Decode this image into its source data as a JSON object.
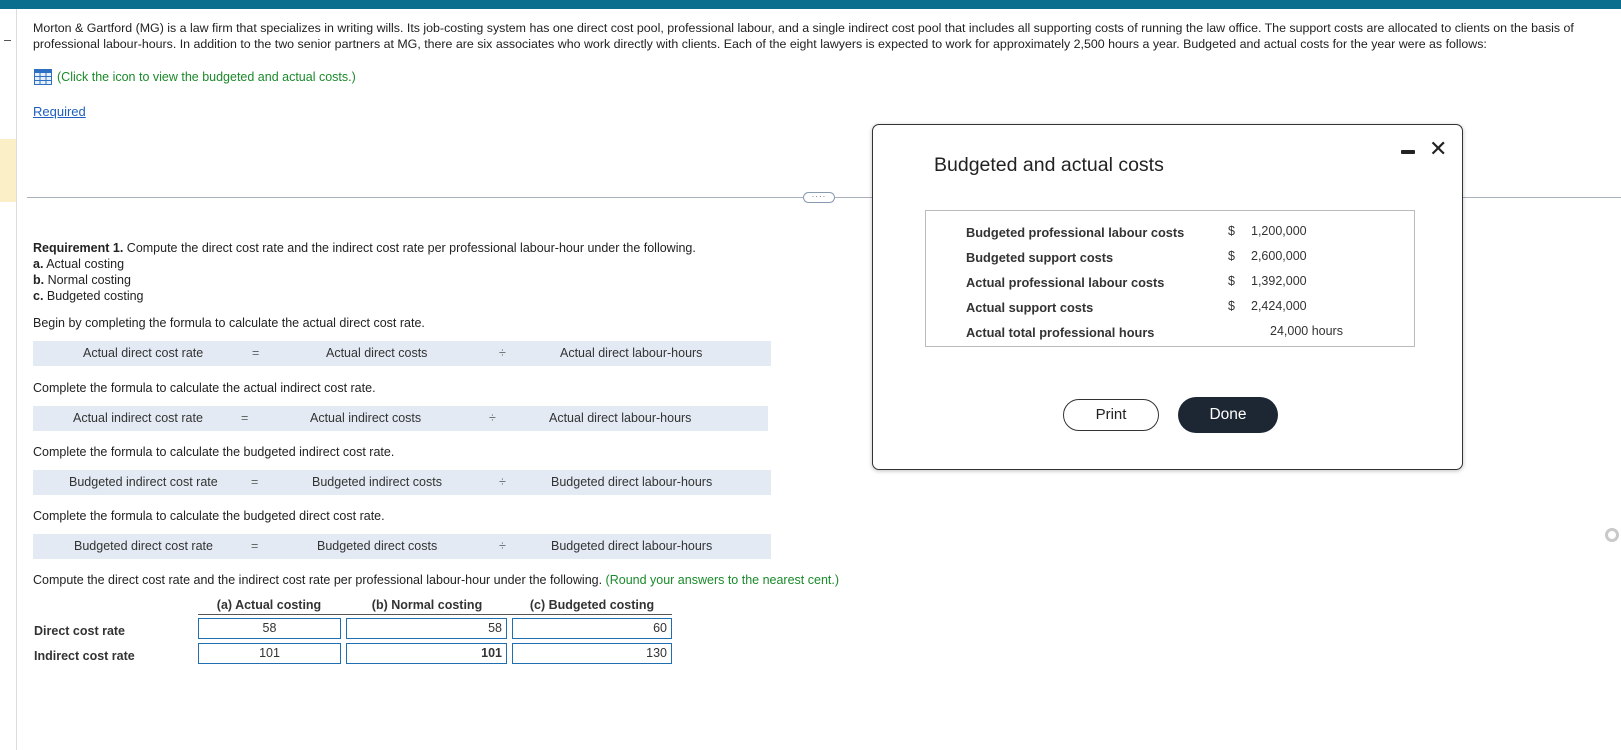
{
  "intro": {
    "text": "Morton & Gartford (MG) is a law firm that specializes in writing wills. Its job-costing system has one direct cost pool, professional labour, and a single indirect cost pool that includes all supporting costs of running the law office. The support costs are allocated to clients on the basis of professional labour-hours. In addition to the two senior partners at MG, there are six associates who work directly with clients. Each of the eight lawyers is expected to work for approximately 2,500 hours a year. Budgeted and actual costs for the year were as follows:",
    "icon_link": "(Click the icon to view the budgeted and actual costs.)",
    "icon": "table-grid-icon",
    "required": "Required"
  },
  "requirement": {
    "heading": "Requirement 1.",
    "text": " Compute the direct cost rate and the indirect cost rate per professional labour-hour under the following.",
    "items": [
      {
        "letter": "a.",
        "text": " Actual costing"
      },
      {
        "letter": "b.",
        "text": " Normal costing"
      },
      {
        "letter": "c.",
        "text": " Budgeted costing"
      }
    ]
  },
  "instructions": {
    "actual_direct": "Begin by completing the formula to calculate the actual direct cost rate.",
    "actual_indirect": "Complete the formula to calculate the actual indirect cost rate.",
    "budgeted_indirect": "Complete the formula to calculate the budgeted indirect cost rate.",
    "budgeted_direct": "Complete the formula to calculate the budgeted direct cost rate."
  },
  "formulas": [
    {
      "lhs": "Actual direct cost rate",
      "eq": "=",
      "num": "Actual direct costs",
      "div": "÷",
      "den": "Actual direct labour-hours"
    },
    {
      "lhs": "Actual indirect cost rate",
      "eq": "=",
      "num": "Actual indirect costs",
      "div": "÷",
      "den": "Actual direct labour-hours"
    },
    {
      "lhs": "Budgeted indirect cost rate",
      "eq": "=",
      "num": "Budgeted indirect costs",
      "div": "÷",
      "den": "Budgeted direct labour-hours"
    },
    {
      "lhs": "Budgeted direct cost rate",
      "eq": "=",
      "num": "Budgeted direct costs",
      "div": "÷",
      "den": "Budgeted direct labour-hours"
    }
  ],
  "compute": {
    "text": "Compute the direct cost rate and the indirect cost rate per professional labour-hour under the following. ",
    "note": "(Round your answers to the nearest cent.)"
  },
  "answer_table": {
    "headers": [
      "(a) Actual costing",
      "(b) Normal costing",
      "(c) Budgeted costing"
    ],
    "rows": [
      {
        "label": "Direct cost rate",
        "values": [
          "58",
          "58",
          "60"
        ]
      },
      {
        "label": "Indirect cost rate",
        "values": [
          "101",
          "101",
          "130"
        ]
      }
    ]
  },
  "modal": {
    "title": "Budgeted and actual costs",
    "rows": [
      {
        "label": "Budgeted professional labour costs",
        "dollar": "$",
        "value": "1,200,000"
      },
      {
        "label": "Budgeted support costs",
        "dollar": "$",
        "value": "2,600,000"
      },
      {
        "label": "Actual professional labour costs",
        "dollar": "$",
        "value": "1,392,000"
      },
      {
        "label": "Actual support costs",
        "dollar": "$",
        "value": "2,424,000"
      },
      {
        "label": "Actual total professional hours",
        "dollar": "",
        "value": "24,000 hours"
      }
    ],
    "print_label": "Print",
    "done_label": "Done",
    "minimize_icon": "minimize-icon",
    "close_icon": "close-icon",
    "close_glyph": "✕"
  },
  "divider_handle": "····"
}
